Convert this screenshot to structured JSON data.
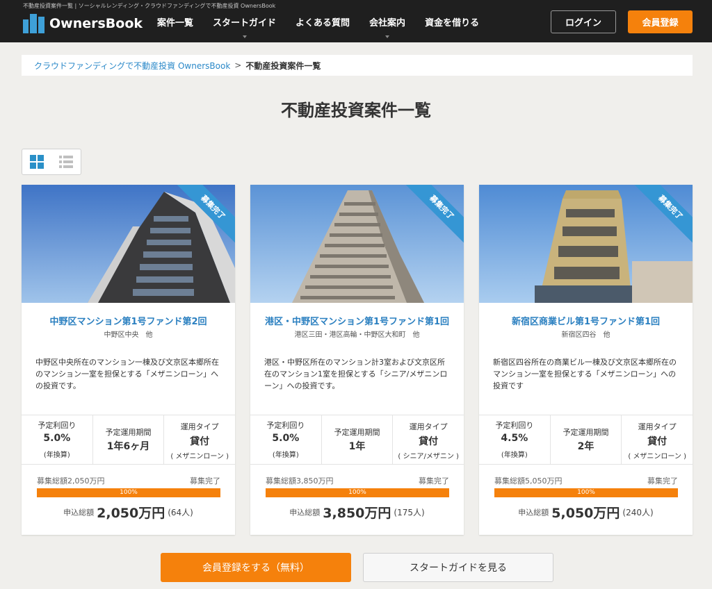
{
  "header": {
    "tagline": "不動産投資案件一覧 | ソーシャルレンディング・クラウドファンディングで不動産投資 OwnersBook",
    "logo_text": "OwnersBook",
    "nav": [
      {
        "label": "案件一覧"
      },
      {
        "label": "スタートガイド"
      },
      {
        "label": "よくある質問"
      },
      {
        "label": "会社案内"
      },
      {
        "label": "資金を借りる"
      }
    ],
    "login_label": "ログイン",
    "register_label": "会員登録"
  },
  "breadcrumb": {
    "home": "クラウドファンディングで不動産投資 OwnersBook",
    "separator": ">",
    "current": "不動産投資案件一覧"
  },
  "page_title": "不動産投資案件一覧",
  "cards": [
    {
      "badge": "募集完了",
      "title": "中野区マンション第1号ファンド第2回",
      "location": "中野区中央　他",
      "description": "中野区中央所在のマンション一棟及び文京区本郷所在のマンション一室を担保とする「メザニンローン」への投資です。",
      "yield_label": "予定利回り",
      "yield_value": "5.0%",
      "yield_note": "(年換算)",
      "period_label": "予定運用期間",
      "period_value": "1年6ヶ月",
      "type_label": "運用タイプ",
      "type_value": "貸付",
      "type_note": "( メザニンローン )",
      "raise_label": "募集総額2,050万円",
      "status": "募集完了",
      "progress_text": "100%",
      "progress": 100,
      "total_label": "申込総額",
      "total_amount": "2,050万円",
      "total_people": "(64人)"
    },
    {
      "badge": "募集完了",
      "title": "港区・中野区マンション第1号ファンド第1回",
      "location": "港区三田・港区高輪・中野区大和町　他",
      "description": "港区・中野区所在のマンション計3室および文京区所在のマンション1室を担保とする「シニア/メザニンローン」への投資です。",
      "yield_label": "予定利回り",
      "yield_value": "5.0%",
      "yield_note": "(年換算)",
      "period_label": "予定運用期間",
      "period_value": "1年",
      "type_label": "運用タイプ",
      "type_value": "貸付",
      "type_note": "( シニア/メザニン )",
      "raise_label": "募集総額3,850万円",
      "status": "募集完了",
      "progress_text": "100%",
      "progress": 100,
      "total_label": "申込総額",
      "total_amount": "3,850万円",
      "total_people": "(175人)"
    },
    {
      "badge": "募集完了",
      "title": "新宿区商業ビル第1号ファンド第1回",
      "location": "新宿区四谷　他",
      "description": "新宿区四谷所在の商業ビル一棟及び文京区本郷所在のマンション一室を担保とする「メザニンローン」への投資です",
      "yield_label": "予定利回り",
      "yield_value": "4.5%",
      "yield_note": "(年換算)",
      "period_label": "予定運用期間",
      "period_value": "2年",
      "type_label": "運用タイプ",
      "type_value": "貸付",
      "type_note": "( メザニンローン )",
      "raise_label": "募集総額5,050万円",
      "status": "募集完了",
      "progress_text": "100%",
      "progress": 100,
      "total_label": "申込総額",
      "total_amount": "5,050万円",
      "total_people": "(240人)"
    }
  ],
  "cta": {
    "primary_label": "会員登録をする（無料）",
    "secondary_label": "スタートガイドを見る"
  },
  "colors": {
    "accent": "#f5810c",
    "link": "#2a7fc0",
    "ribbon": "#3596d4",
    "header_bg": "#1f1f1f"
  }
}
